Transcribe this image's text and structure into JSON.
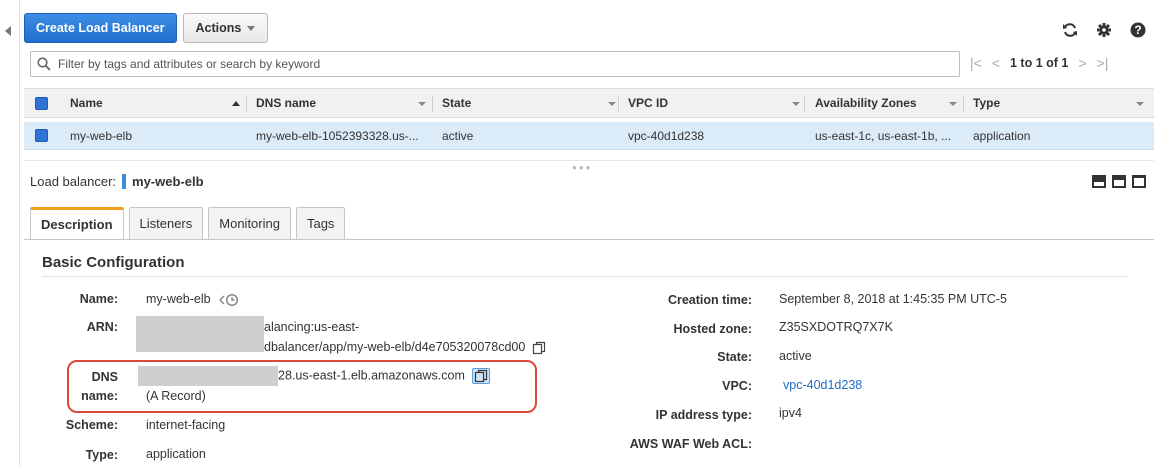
{
  "toolbar": {
    "create_label": "Create Load Balancer",
    "actions_label": "Actions"
  },
  "search": {
    "placeholder": "Filter by tags and attributes or search by keyword"
  },
  "pager": {
    "range": "1 to 1 of 1"
  },
  "table": {
    "columns": [
      "Name",
      "DNS name",
      "State",
      "VPC ID",
      "Availability Zones",
      "Type"
    ],
    "rows": [
      {
        "name": "my-web-elb",
        "dns": "my-web-elb-1052393328.us-...",
        "state": "active",
        "vpc": "vpc-40d1d238",
        "az": "us-east-1c, us-east-1b, ...",
        "type": "application"
      }
    ]
  },
  "detail": {
    "label": "Load balancer:",
    "name": "my-web-elb"
  },
  "tabs": [
    "Description",
    "Listeners",
    "Monitoring",
    "Tags"
  ],
  "basic": {
    "title": "Basic Configuration",
    "name_label": "Name:",
    "name_value": "my-web-elb",
    "arn_label": "ARN:",
    "arn_line1": "alancing:us-east-",
    "arn_line2": "dbalancer/app/my-web-elb/d4e705320078cd00",
    "dns_label_1": "DNS",
    "dns_label_2": "name:",
    "dns_value": "28.us-east-1.elb.amazonaws.com",
    "dns_record": "(A Record)",
    "scheme_label": "Scheme:",
    "scheme_value": "internet-facing",
    "type_label": "Type:",
    "type_value": "application",
    "creation_label": "Creation time:",
    "creation_value": "September 8, 2018 at 1:45:35 PM UTC-5",
    "zone_label": "Hosted zone:",
    "zone_value": "Z35SXDOTRQ7X7K",
    "state_label": "State:",
    "state_value": "active",
    "vpc_label": "VPC:",
    "vpc_value": "vpc-40d1d238",
    "ipt_label": "IP address type:",
    "ipt_value": "ipv4",
    "waf_label": "AWS WAF Web ACL:"
  },
  "colors": {
    "primary": "#1f6fce",
    "link": "#1f6cc4",
    "selected_row": "#dcebf8",
    "active_tab": "#f0a01e",
    "callout": "#d9493a"
  }
}
